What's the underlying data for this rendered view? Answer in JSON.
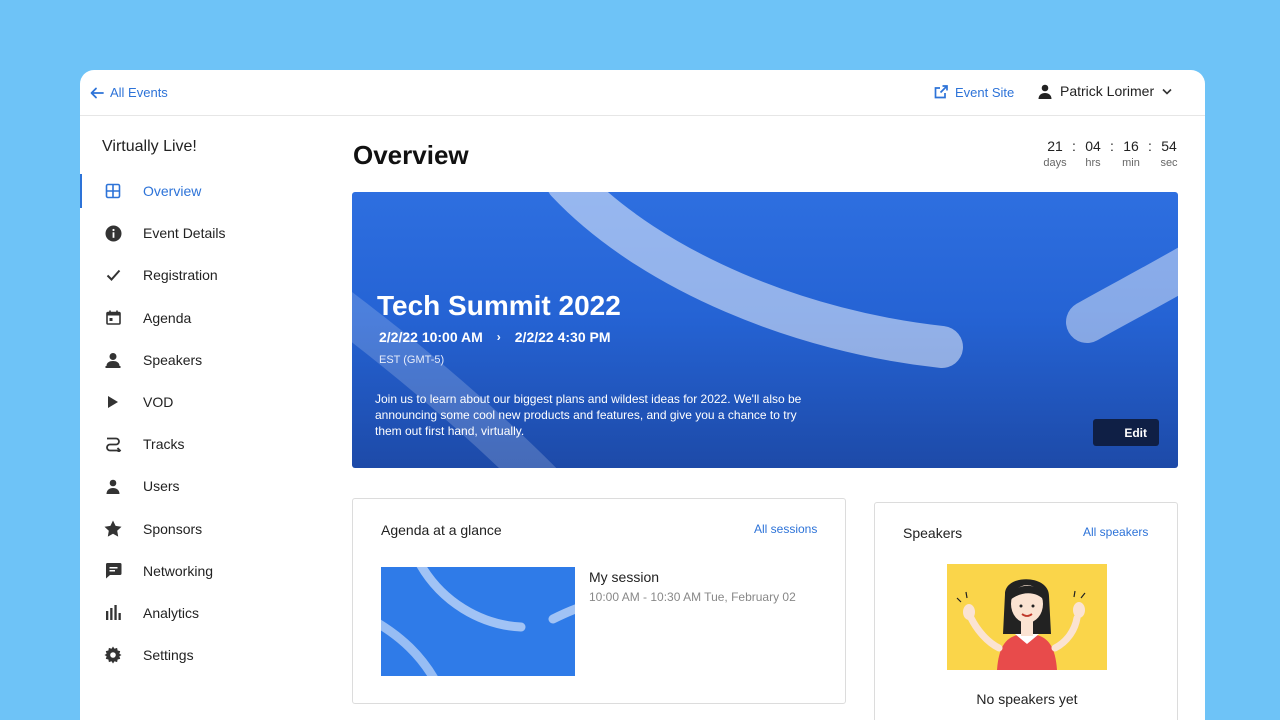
{
  "topbar": {
    "back_label": "All Events",
    "event_site_label": "Event Site",
    "user_name": "Patrick Lorimer"
  },
  "sidebar": {
    "app_name": "Virtually Live!",
    "items": [
      {
        "label": "Overview",
        "icon": "grid-icon",
        "active": true
      },
      {
        "label": "Event Details",
        "icon": "info-icon"
      },
      {
        "label": "Registration",
        "icon": "check-icon"
      },
      {
        "label": "Agenda",
        "icon": "calendar-icon"
      },
      {
        "label": "Speakers",
        "icon": "speaker-icon"
      },
      {
        "label": "VOD",
        "icon": "play-icon"
      },
      {
        "label": "Tracks",
        "icon": "tracks-icon"
      },
      {
        "label": "Users",
        "icon": "user-icon"
      },
      {
        "label": "Sponsors",
        "icon": "star-icon"
      },
      {
        "label": "Networking",
        "icon": "chat-icon"
      },
      {
        "label": "Analytics",
        "icon": "bar-chart-icon"
      },
      {
        "label": "Settings",
        "icon": "gear-icon"
      }
    ]
  },
  "main": {
    "title": "Overview",
    "countdown": {
      "days": "21",
      "hrs": "04",
      "min": "16",
      "sec": "54",
      "days_label": "days",
      "hrs_label": "hrs",
      "min_label": "min",
      "sec_label": "sec",
      "separator": ":"
    },
    "hero": {
      "title": "Tech Summit 2022",
      "start": "2/2/22 10:00 AM",
      "end": "2/2/22 4:30 PM",
      "timezone": "EST (GMT-5)",
      "description": "Join us to learn about our biggest plans and wildest ideas for 2022. We'll also be announcing some cool new products and features, and give you a chance to try them out first hand, virtually.",
      "edit_label": "Edit"
    },
    "agenda": {
      "title": "Agenda at a glance",
      "link": "All sessions",
      "session_name": "My session",
      "session_time": "10:00 AM - 10:30 AM  Tue, February 02"
    },
    "speakers": {
      "title": "Speakers",
      "link": "All speakers",
      "empty": "No speakers yet"
    }
  },
  "colors": {
    "background": "#6ec3f7",
    "accent": "#2d73d8",
    "hero": "#2563d4",
    "edit_button": "#0f1f45",
    "illustration": "#fad54a"
  }
}
